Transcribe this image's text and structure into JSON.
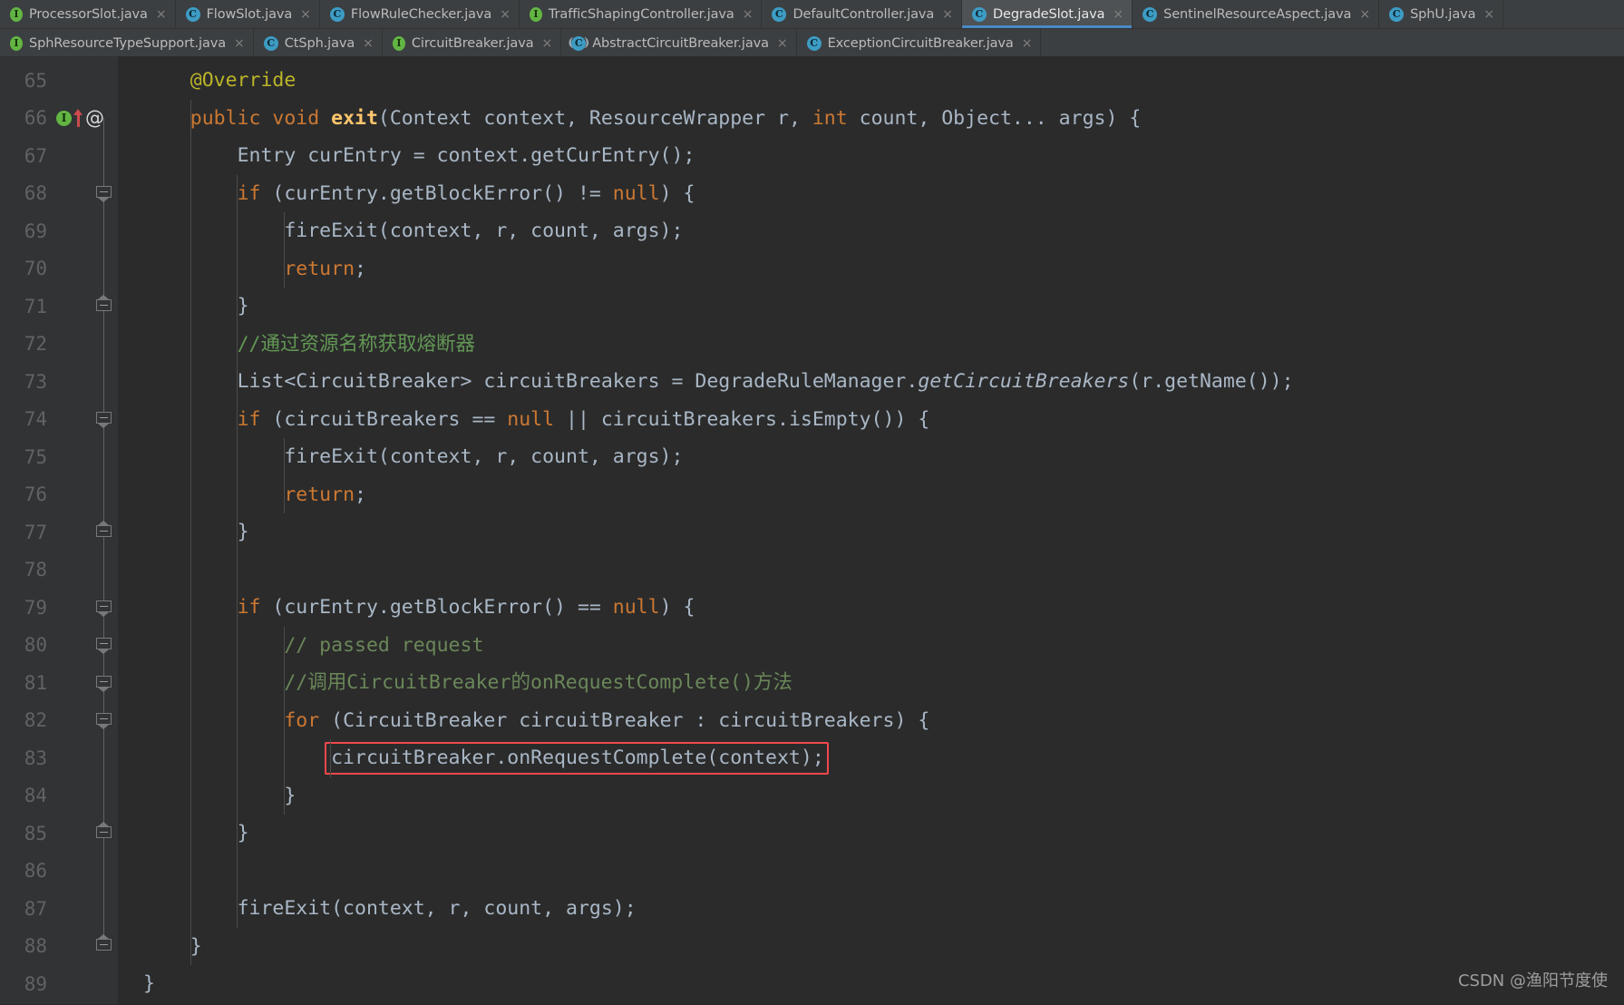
{
  "window": {
    "theme": "darcula",
    "background": "#2B2B2B",
    "accent": "#4A88C7",
    "highlight_box_color": "#F3484B"
  },
  "tabs_row1": [
    {
      "label": "ProcessorSlot.java",
      "icon": "interface-icon",
      "icon_letter": "I",
      "kind": "interface",
      "active": false,
      "close_glyph": "×"
    },
    {
      "label": "FlowSlot.java",
      "icon": "class-icon",
      "icon_letter": "C",
      "kind": "class",
      "active": false,
      "close_glyph": "×"
    },
    {
      "label": "FlowRuleChecker.java",
      "icon": "class-icon",
      "icon_letter": "C",
      "kind": "class",
      "active": false,
      "close_glyph": "×"
    },
    {
      "label": "TrafficShapingController.java",
      "icon": "interface-icon",
      "icon_letter": "I",
      "kind": "interface",
      "active": false,
      "close_glyph": "×"
    },
    {
      "label": "DefaultController.java",
      "icon": "class-icon",
      "icon_letter": "C",
      "kind": "class",
      "active": false,
      "close_glyph": "×"
    },
    {
      "label": "DegradeSlot.java",
      "icon": "class-icon",
      "icon_letter": "C",
      "kind": "class",
      "active": true,
      "close_glyph": "×"
    },
    {
      "label": "SentinelResourceAspect.java",
      "icon": "class-icon",
      "icon_letter": "C",
      "kind": "class",
      "active": false,
      "close_glyph": "×"
    },
    {
      "label": "SphU.java",
      "icon": "class-icon",
      "icon_letter": "C",
      "kind": "class",
      "active": false,
      "close_glyph": "×"
    }
  ],
  "tabs_row2": [
    {
      "label": "SphResourceTypeSupport.java",
      "icon": "interface-icon",
      "icon_letter": "I",
      "kind": "interface",
      "active": false,
      "close_glyph": "×"
    },
    {
      "label": "CtSph.java",
      "icon": "class-icon",
      "icon_letter": "C",
      "kind": "class",
      "active": false,
      "close_glyph": "×"
    },
    {
      "label": "CircuitBreaker.java",
      "icon": "interface-icon",
      "icon_letter": "I",
      "kind": "interface",
      "active": false,
      "close_glyph": "×"
    },
    {
      "label": "AbstractCircuitBreaker.java",
      "icon": "abstract-class-icon",
      "icon_letter": "C",
      "kind": "abstract",
      "active": false,
      "close_glyph": "×"
    },
    {
      "label": "ExceptionCircuitBreaker.java",
      "icon": "class-icon",
      "icon_letter": "C",
      "kind": "class",
      "active": false,
      "close_glyph": "×"
    }
  ],
  "gutter": {
    "line_numbers": [
      65,
      66,
      67,
      68,
      69,
      70,
      71,
      72,
      73,
      74,
      75,
      76,
      77,
      78,
      79,
      80,
      81,
      82,
      83,
      84,
      85,
      86,
      87,
      88,
      89
    ],
    "markers": {
      "66": {
        "implementing_method_icon": "I",
        "override_arrow": "up-arrow",
        "annotation_mark": "@"
      }
    }
  },
  "code": {
    "language": "java",
    "file": "DegradeSlot.java",
    "lines": [
      {
        "n": 65,
        "tokens": [
          {
            "t": "@Override",
            "c": "ann",
            "indent": 4
          }
        ]
      },
      {
        "n": 66,
        "tokens": [
          {
            "t": "public void ",
            "c": "kw",
            "indent": 4
          },
          {
            "t": "exit",
            "c": "mdec"
          },
          {
            "t": "(Context context, ResourceWrapper r, ",
            "c": "txt"
          },
          {
            "t": "int",
            "c": "kw"
          },
          {
            "t": " count, Object... args) {",
            "c": "txt"
          }
        ]
      },
      {
        "n": 67,
        "tokens": [
          {
            "t": "Entry curEntry = context.getCurEntry();",
            "c": "txt",
            "indent": 8
          }
        ]
      },
      {
        "n": 68,
        "tokens": [
          {
            "t": "if",
            "c": "kw",
            "indent": 8
          },
          {
            "t": " (curEntry.getBlockError() != ",
            "c": "txt"
          },
          {
            "t": "null",
            "c": "kw"
          },
          {
            "t": ") {",
            "c": "txt"
          }
        ]
      },
      {
        "n": 69,
        "tokens": [
          {
            "t": "fireExit(context, r, count, args);",
            "c": "txt",
            "indent": 12
          }
        ]
      },
      {
        "n": 70,
        "tokens": [
          {
            "t": "return",
            "c": "kw",
            "indent": 12
          },
          {
            "t": ";",
            "c": "txt"
          }
        ]
      },
      {
        "n": 71,
        "tokens": [
          {
            "t": "}",
            "c": "txt",
            "indent": 8
          }
        ]
      },
      {
        "n": 72,
        "tokens": [
          {
            "t": "//通过资源名称获取熔断器",
            "c": "cmt",
            "indent": 8
          }
        ]
      },
      {
        "n": 73,
        "tokens": [
          {
            "t": "List<CircuitBreaker> circuitBreakers = DegradeRuleManager.",
            "c": "txt",
            "indent": 8
          },
          {
            "t": "getCircuitBreakers",
            "c": "ital"
          },
          {
            "t": "(r.getName());",
            "c": "txt"
          }
        ]
      },
      {
        "n": 74,
        "tokens": [
          {
            "t": "if",
            "c": "kw",
            "indent": 8
          },
          {
            "t": " (circuitBreakers == ",
            "c": "txt"
          },
          {
            "t": "null",
            "c": "kw"
          },
          {
            "t": " || circuitBreakers.isEmpty()) {",
            "c": "txt"
          }
        ]
      },
      {
        "n": 75,
        "tokens": [
          {
            "t": "fireExit(context, r, count, args);",
            "c": "txt",
            "indent": 12
          }
        ]
      },
      {
        "n": 76,
        "tokens": [
          {
            "t": "return",
            "c": "kw",
            "indent": 12
          },
          {
            "t": ";",
            "c": "txt"
          }
        ]
      },
      {
        "n": 77,
        "tokens": [
          {
            "t": "}",
            "c": "txt",
            "indent": 8
          }
        ]
      },
      {
        "n": 78,
        "tokens": []
      },
      {
        "n": 79,
        "tokens": [
          {
            "t": "if",
            "c": "kw",
            "indent": 8
          },
          {
            "t": " (curEntry.getBlockError() == ",
            "c": "txt"
          },
          {
            "t": "null",
            "c": "kw"
          },
          {
            "t": ") {",
            "c": "txt"
          }
        ]
      },
      {
        "n": 80,
        "tokens": [
          {
            "t": "// passed request",
            "c": "cmt2",
            "indent": 12
          }
        ]
      },
      {
        "n": 81,
        "tokens": [
          {
            "t": "//调用CircuitBreaker的onRequestComplete()方法",
            "c": "cmt2",
            "indent": 12
          }
        ]
      },
      {
        "n": 82,
        "tokens": [
          {
            "t": "for",
            "c": "kw",
            "indent": 12
          },
          {
            "t": " (CircuitBreaker circuitBreaker : circuitBreakers) {",
            "c": "txt"
          }
        ]
      },
      {
        "n": 83,
        "tokens": [
          {
            "t": "circuitBreaker.onRequestComplete(context);",
            "c": "txt",
            "indent": 16
          }
        ],
        "highlighted": true
      },
      {
        "n": 84,
        "tokens": [
          {
            "t": "}",
            "c": "txt",
            "indent": 12
          }
        ]
      },
      {
        "n": 85,
        "tokens": [
          {
            "t": "}",
            "c": "txt",
            "indent": 8
          }
        ]
      },
      {
        "n": 86,
        "tokens": []
      },
      {
        "n": 87,
        "tokens": [
          {
            "t": "fireExit(context, r, count, args);",
            "c": "txt",
            "indent": 8
          }
        ]
      },
      {
        "n": 88,
        "tokens": [
          {
            "t": "}",
            "c": "txt",
            "indent": 4
          }
        ]
      },
      {
        "n": 89,
        "tokens": [
          {
            "t": "}",
            "c": "txt",
            "indent": 0
          }
        ]
      }
    ]
  },
  "watermark": {
    "text": "CSDN @渔阳节度使"
  }
}
